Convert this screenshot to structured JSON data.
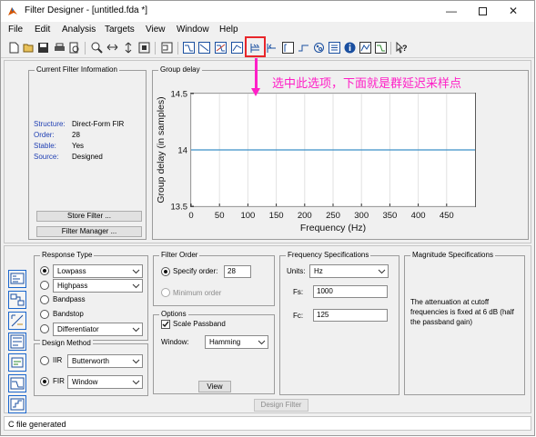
{
  "window": {
    "title": "Filter Designer - [untitled.fda *]",
    "controls": [
      "minimize",
      "maximize",
      "close"
    ]
  },
  "menu": [
    "File",
    "Edit",
    "Analysis",
    "Targets",
    "View",
    "Window",
    "Help"
  ],
  "toolbar_icons": [
    "new-icon",
    "open-icon",
    "save-icon",
    "print-icon",
    "print-preview-icon",
    "zoom-in-icon",
    "zoom-x-icon",
    "zoom-y-icon",
    "full-view-icon",
    "filter-spec-icon",
    "magnitude-response-icon",
    "phase-response-icon",
    "mag-phase-response-icon",
    "group-delay-icon",
    "phase-delay-icon",
    "impulse-response-icon",
    "step-response-icon",
    "pole-zero-icon",
    "filter-coefficients-icon",
    "filter-info-icon",
    "round-off-noise-icon",
    "magnitude-estimate-icon",
    "whats-this-icon"
  ],
  "highlight": {
    "color": "#e8262a"
  },
  "annotation": {
    "text": "选中此选项，下面就是群延迟采样点",
    "color": "#ff1fc7"
  },
  "current_filter": {
    "title": "Current Filter Information",
    "rows": [
      {
        "key": "Structure:",
        "value": "Direct-Form FIR"
      },
      {
        "key": "Order:",
        "value": "28"
      },
      {
        "key": "Stable:",
        "value": "Yes"
      },
      {
        "key": "Source:",
        "value": "Designed"
      }
    ],
    "store_button": "Store Filter ...",
    "manager_button": "Filter Manager ...",
    "key_color": "#1f3fb3"
  },
  "analysis_panel": {
    "title": "Group delay"
  },
  "chart_data": {
    "type": "line",
    "xlabel": "Frequency (Hz)",
    "ylabel": "Group delay (in samples)",
    "xlim": [
      0,
      500
    ],
    "ylim": [
      13.5,
      14.5
    ],
    "xticks": [
      0,
      50,
      100,
      150,
      200,
      250,
      300,
      350,
      400,
      450
    ],
    "yticks": [
      13.5,
      14,
      14.5
    ],
    "grid": true,
    "series": [
      {
        "x": [
          0,
          500
        ],
        "y": [
          14,
          14
        ],
        "color": "#3b8fc8"
      }
    ]
  },
  "response_type": {
    "title": "Response Type",
    "options": [
      {
        "label": "Lowpass",
        "checked": true,
        "dropdown": true
      },
      {
        "label": "Highpass",
        "checked": false,
        "dropdown": true
      },
      {
        "label": "Bandpass",
        "checked": false,
        "dropdown": false
      },
      {
        "label": "Bandstop",
        "checked": false,
        "dropdown": false
      },
      {
        "label": "Differentiator",
        "checked": false,
        "dropdown": true
      }
    ]
  },
  "design_method": {
    "title": "Design Method",
    "iir": {
      "label": "IIR",
      "value": "Butterworth",
      "checked": false
    },
    "fir": {
      "label": "FIR",
      "value": "Window",
      "checked": true
    }
  },
  "filter_order": {
    "title": "Filter Order",
    "specify_label": "Specify order:",
    "specify_value": "28",
    "minimum_label": "Minimum order"
  },
  "options": {
    "title": "Options",
    "scale_passband": "Scale Passband",
    "window_label": "Window:",
    "window_value": "Hamming",
    "view_button": "View"
  },
  "frequency_specs": {
    "title": "Frequency Specifications",
    "units_label": "Units:",
    "units_value": "Hz",
    "fs_label": "Fs:",
    "fs_value": "1000",
    "fc_label": "Fc:",
    "fc_value": "125"
  },
  "magnitude_specs": {
    "title": "Magnitude Specifications",
    "description": "The attenuation at cutoff frequencies is fixed at 6 dB (half the passband gain)"
  },
  "design_button": "Design Filter",
  "side_icons": [
    "pole-zero-editor-icon",
    "transform-filter-icon",
    "create-multirate-icon",
    "realize-model-icon",
    "import-filter-icon",
    "design-filter-icon",
    "quantization-icon",
    "sidebar-panel-icon"
  ],
  "status": "C file generated"
}
